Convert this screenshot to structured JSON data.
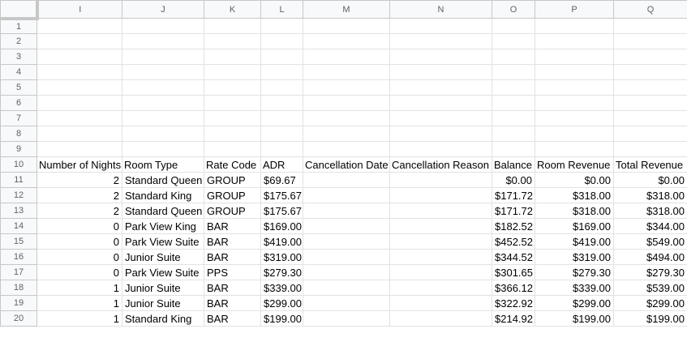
{
  "columns": [
    "I",
    "J",
    "K",
    "L",
    "M",
    "N",
    "O",
    "P",
    "Q"
  ],
  "empty_rows": [
    "1",
    "2",
    "3",
    "4",
    "5",
    "6",
    "7",
    "8",
    "9"
  ],
  "header": {
    "row": "10",
    "cells": [
      "Number of Nights",
      "Room Type",
      "Rate Code",
      "ADR",
      "Cancellation Date",
      "Cancellation Reason",
      "Balance",
      "Room Revenue",
      "Total Revenue"
    ]
  },
  "data_rows": [
    {
      "row": "11",
      "cells": [
        "2",
        "Standard Queen",
        "GROUP",
        "$69.67",
        "",
        "",
        "$0.00",
        "$0.00",
        "$0.00"
      ]
    },
    {
      "row": "12",
      "cells": [
        "2",
        "Standard King",
        "GROUP",
        "$175.67",
        "",
        "",
        "$171.72",
        "$318.00",
        "$318.00"
      ]
    },
    {
      "row": "13",
      "cells": [
        "2",
        "Standard Queen",
        "GROUP",
        "$175.67",
        "",
        "",
        "$171.72",
        "$318.00",
        "$318.00"
      ]
    },
    {
      "row": "14",
      "cells": [
        "0",
        "Park View King",
        "BAR",
        "$169.00",
        "",
        "",
        "$182.52",
        "$169.00",
        "$344.00"
      ]
    },
    {
      "row": "15",
      "cells": [
        "0",
        "Park View Suite",
        "BAR",
        "$419.00",
        "",
        "",
        "$452.52",
        "$419.00",
        "$549.00"
      ]
    },
    {
      "row": "16",
      "cells": [
        "0",
        "Junior Suite",
        "BAR",
        "$319.00",
        "",
        "",
        "$344.52",
        "$319.00",
        "$494.00"
      ]
    },
    {
      "row": "17",
      "cells": [
        "0",
        "Park View Suite",
        "PPS",
        "$279.30",
        "",
        "",
        "$301.65",
        "$279.30",
        "$279.30"
      ]
    },
    {
      "row": "18",
      "cells": [
        "1",
        "Junior Suite",
        "BAR",
        "$339.00",
        "",
        "",
        "$366.12",
        "$339.00",
        "$539.00"
      ]
    },
    {
      "row": "19",
      "cells": [
        "1",
        "Junior Suite",
        "BAR",
        "$299.00",
        "",
        "",
        "$322.92",
        "$299.00",
        "$299.00"
      ]
    },
    {
      "row": "20",
      "cells": [
        "1",
        "Standard King",
        "BAR",
        "$199.00",
        "",
        "",
        "$214.92",
        "$199.00",
        "$199.00"
      ]
    }
  ]
}
